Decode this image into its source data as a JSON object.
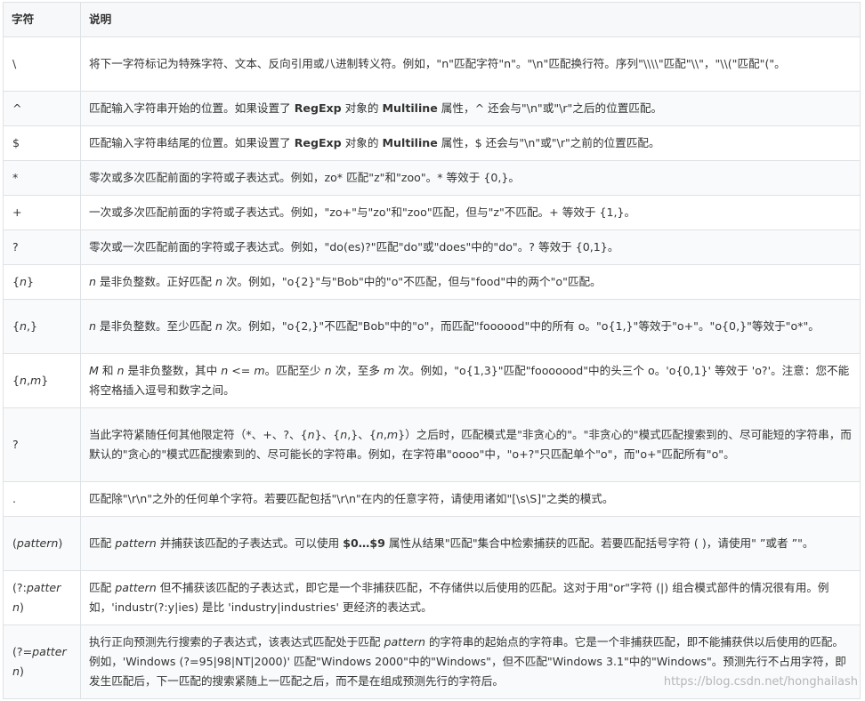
{
  "headers": {
    "symbol": "字符",
    "desc": "说明"
  },
  "rows": [
    {
      "sym": [
        {
          "t": "\\"
        }
      ],
      "desc": [
        {
          "t": "将下一字符标记为特殊字符、文本、反向引用或八进制转义符。例如，\"n\"匹配字符\"n\"。\"\\n\"匹配换行符。序列\"\\\\\\\\\"匹配\"\\\\\"，\"\\\\(\"匹配\"(\"。"
        }
      ]
    },
    {
      "sym": [
        {
          "t": "^"
        }
      ],
      "desc": [
        {
          "t": "匹配输入字符串开始的位置。如果设置了 "
        },
        {
          "t": "RegExp",
          "s": "b"
        },
        {
          "t": " 对象的 "
        },
        {
          "t": "Multiline",
          "s": "b"
        },
        {
          "t": " 属性，^ 还会与\"\\n\"或\"\\r\"之后的位置匹配。"
        }
      ]
    },
    {
      "sym": [
        {
          "t": "$"
        }
      ],
      "desc": [
        {
          "t": "匹配输入字符串结尾的位置。如果设置了 "
        },
        {
          "t": "RegExp",
          "s": "b"
        },
        {
          "t": " 对象的 "
        },
        {
          "t": "Multiline",
          "s": "b"
        },
        {
          "t": " 属性，$ 还会与\"\\n\"或\"\\r\"之前的位置匹配。"
        }
      ]
    },
    {
      "sym": [
        {
          "t": "*"
        }
      ],
      "desc": [
        {
          "t": "零次或多次匹配前面的字符或子表达式。例如，zo* 匹配\"z\"和\"zoo\"。* 等效于 {0,}。"
        }
      ]
    },
    {
      "sym": [
        {
          "t": "+"
        }
      ],
      "desc": [
        {
          "t": "一次或多次匹配前面的字符或子表达式。例如，\"zo+\"与\"zo\"和\"zoo\"匹配，但与\"z\"不匹配。+ 等效于 {1,}。"
        }
      ]
    },
    {
      "sym": [
        {
          "t": "?"
        }
      ],
      "desc": [
        {
          "t": "零次或一次匹配前面的字符或子表达式。例如，\"do(es)?\"匹配\"do\"或\"does\"中的\"do\"。? 等效于 {0,1}。"
        }
      ]
    },
    {
      "sym": [
        {
          "t": "{"
        },
        {
          "t": "n",
          "s": "i"
        },
        {
          "t": "}"
        }
      ],
      "desc": [
        {
          "t": "n",
          "s": "i"
        },
        {
          "t": " 是非负整数。正好匹配 "
        },
        {
          "t": "n",
          "s": "i"
        },
        {
          "t": " 次。例如，\"o{2}\"与\"Bob\"中的\"o\"不匹配，但与\"food\"中的两个\"o\"匹配。"
        }
      ]
    },
    {
      "sym": [
        {
          "t": "{"
        },
        {
          "t": "n",
          "s": "i"
        },
        {
          "t": ",}"
        }
      ],
      "desc": [
        {
          "t": "n",
          "s": "i"
        },
        {
          "t": " 是非负整数。至少匹配 "
        },
        {
          "t": "n",
          "s": "i"
        },
        {
          "t": " 次。例如，\"o{2,}\"不匹配\"Bob\"中的\"o\"，而匹配\"foooood\"中的所有 o。\"o{1,}\"等效于\"o+\"。\"o{0,}\"等效于\"o*\"。"
        }
      ]
    },
    {
      "sym": [
        {
          "t": "{"
        },
        {
          "t": "n",
          "s": "i"
        },
        {
          "t": ","
        },
        {
          "t": "m",
          "s": "i"
        },
        {
          "t": "}"
        }
      ],
      "desc": [
        {
          "t": "M",
          "s": "i"
        },
        {
          "t": " 和 "
        },
        {
          "t": "n",
          "s": "i"
        },
        {
          "t": " 是非负整数，其中 "
        },
        {
          "t": "n",
          "s": "i"
        },
        {
          "t": " <= "
        },
        {
          "t": "m",
          "s": "i"
        },
        {
          "t": "。匹配至少 "
        },
        {
          "t": "n",
          "s": "i"
        },
        {
          "t": " 次，至多 "
        },
        {
          "t": "m",
          "s": "i"
        },
        {
          "t": " 次。例如，\"o{1,3}\"匹配\"fooooood\"中的头三个 o。'o{0,1}' 等效于 'o?'。注意：您不能将空格插入逗号和数字之间。"
        }
      ]
    },
    {
      "sym": [
        {
          "t": "?"
        }
      ],
      "desc": [
        {
          "t": "当此字符紧随任何其他限定符（*、+、?、{"
        },
        {
          "t": "n",
          "s": "i"
        },
        {
          "t": "}、{"
        },
        {
          "t": "n",
          "s": "i"
        },
        {
          "t": ",}、{"
        },
        {
          "t": "n",
          "s": "i"
        },
        {
          "t": ","
        },
        {
          "t": "m",
          "s": "i"
        },
        {
          "t": "}）之后时，匹配模式是\"非贪心的\"。\"非贪心的\"模式匹配搜索到的、尽可能短的字符串，而默认的\"贪心的\"模式匹配搜索到的、尽可能长的字符串。例如，在字符串\"oooo\"中，\"o+?\"只匹配单个\"o\"，而\"o+\"匹配所有\"o\"。"
        }
      ]
    },
    {
      "sym": [
        {
          "t": "."
        }
      ],
      "desc": [
        {
          "t": "匹配除\"\\r\\n\"之外的任何单个字符。若要匹配包括\"\\r\\n\"在内的任意字符，请使用诸如\"[\\s\\S]\"之类的模式。"
        }
      ]
    },
    {
      "sym": [
        {
          "t": "("
        },
        {
          "t": "pattern",
          "s": "i"
        },
        {
          "t": ")"
        }
      ],
      "desc": [
        {
          "t": "匹配 "
        },
        {
          "t": "pattern",
          "s": "i"
        },
        {
          "t": " 并捕获该匹配的子表达式。可以使用 "
        },
        {
          "t": "$0…$9",
          "s": "b"
        },
        {
          "t": " 属性从结果\"匹配\"集合中检索捕获的匹配。若要匹配括号字符 ( )，请使用\" ”或者 ”\"。"
        }
      ]
    },
    {
      "sym": [
        {
          "t": "(?:"
        },
        {
          "t": "pattern",
          "s": "i"
        },
        {
          "t": ")"
        }
      ],
      "desc": [
        {
          "t": "匹配 "
        },
        {
          "t": "pattern",
          "s": "i"
        },
        {
          "t": " 但不捕获该匹配的子表达式，即它是一个非捕获匹配，不存储供以后使用的匹配。这对于用\"or\"字符 (|) 组合模式部件的情况很有用。例如，'industr(?:y|ies) 是比 'industry|industries' 更经济的表达式。"
        }
      ]
    },
    {
      "sym": [
        {
          "t": "(?="
        },
        {
          "t": "pattern",
          "s": "i"
        },
        {
          "t": ")"
        }
      ],
      "desc": [
        {
          "t": "执行正向预测先行搜索的子表达式，该表达式匹配处于匹配 "
        },
        {
          "t": "pattern",
          "s": "i"
        },
        {
          "t": " 的字符串的起始点的字符串。它是一个非捕获匹配，即不能捕获供以后使用的匹配。例如，'Windows (?=95|98|NT|2000)' 匹配\"Windows 2000\"中的\"Windows\"，但不匹配\"Windows 3.1\"中的\"Windows\"。预测先行不占用字符，即发生匹配后，下一匹配的搜索紧随上一匹配之后，而不是在组成预测先行的字符后。"
        }
      ]
    }
  ],
  "watermark": "https://blog.csdn.net/honghailash"
}
